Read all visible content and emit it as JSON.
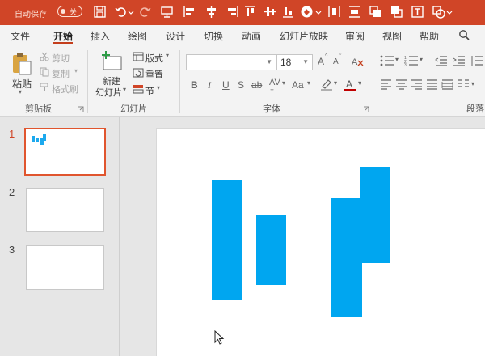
{
  "qat": {
    "autosave_label": "自动保存",
    "autosave_state": "关",
    "icons": [
      "save-icon",
      "undo-icon",
      "redo-icon",
      "presentation-icon",
      "align-left-icon",
      "align-center-icon",
      "align-right-icon",
      "align-top-icon",
      "align-middle-icon",
      "align-bottom-icon",
      "shape-fill-icon",
      "distribute-horizontal-icon",
      "distribute-vertical-icon",
      "group-icon",
      "textbox-icon",
      "shapes-icon"
    ]
  },
  "tabs": [
    "文件",
    "开始",
    "插入",
    "绘图",
    "设计",
    "切换",
    "动画",
    "幻灯片放映",
    "审阅",
    "视图",
    "帮助"
  ],
  "tabs_active_index": 1,
  "ribbon": {
    "clipboard": {
      "paste": "粘贴",
      "cut": "剪切",
      "copy": "复制",
      "format_painter": "格式刷",
      "label": "剪贴板"
    },
    "slides": {
      "new_slide_line1": "新建",
      "new_slide_line2": "幻灯片",
      "layout": "版式",
      "reset": "重置",
      "section": "节",
      "label": "幻灯片"
    },
    "font": {
      "font_name": "",
      "font_size": "18",
      "bold": "B",
      "italic": "I",
      "underline": "U",
      "shadow": "S",
      "strikethrough": "ab",
      "spacing": "AV",
      "case": "Aa",
      "grow": "A",
      "shrink": "A",
      "label": "字体"
    },
    "paragraph": {
      "label": "段落"
    }
  },
  "thumbnails": {
    "numbers": [
      "1",
      "2",
      "3"
    ],
    "active_index": 0
  },
  "colors": {
    "accent": "#d04527",
    "bar": "#00a6f0",
    "thumb_border": "#e0552e"
  }
}
